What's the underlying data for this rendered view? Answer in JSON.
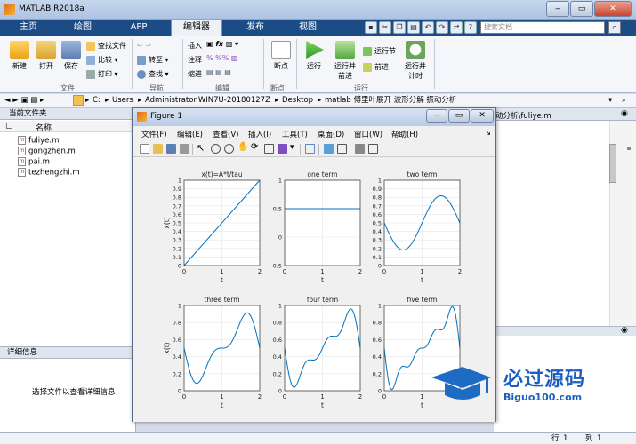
{
  "app": {
    "title": "MATLAB R2018a"
  },
  "tabs": [
    {
      "label": "主页"
    },
    {
      "label": "绘图"
    },
    {
      "label": "APP"
    },
    {
      "label": "编辑器"
    },
    {
      "label": "发布"
    },
    {
      "label": "视图"
    }
  ],
  "search": {
    "placeholder": "搜索文档"
  },
  "ribbon": {
    "new": "新建",
    "open": "打开",
    "save": "保存",
    "find_files": "查找文件",
    "compare": "比较",
    "print": "打印",
    "insert": "插入",
    "comment": "注释",
    "indent": "缩进",
    "goto": "转至",
    "find": "查找",
    "breakpoint": "断点",
    "run": "运行",
    "run_advance": "运行并\n前进",
    "run_section": "运行节",
    "advance": "前进",
    "run_time": "运行并\n计时",
    "groups": {
      "file": "文件",
      "nav": "导航",
      "edit": "编辑",
      "bp": "断点",
      "run": "运行"
    }
  },
  "address": {
    "segments": [
      "C:",
      "Users",
      "Administrator.WIN7U-20180127Z",
      "Desktop",
      "matlab 傅里叶展开 波形分解 振动分析"
    ]
  },
  "left_panel": {
    "title": "当前文件夹",
    "column": "名称",
    "files": [
      "fuliye.m",
      "gongzhen.m",
      "pai.m",
      "tezhengzhi.m"
    ],
    "details_title": "详细信息",
    "details_hint": "选择文件以查看详细信息"
  },
  "editor": {
    "tab_text": "动分析\\fuliye.m"
  },
  "status": {
    "row_label": "行",
    "row": "1",
    "col_label": "列",
    "col": "1"
  },
  "figure": {
    "title": "Figure 1",
    "menu": [
      "文件(F)",
      "编辑(E)",
      "查看(V)",
      "插入(I)",
      "工具(T)",
      "桌面(D)",
      "窗口(W)",
      "帮助(H)"
    ]
  },
  "chart_data": [
    {
      "type": "line",
      "title": "x(t)=A*t/tau",
      "xlabel": "t",
      "ylabel": "x(t)",
      "xlim": [
        0,
        2
      ],
      "ylim": [
        0,
        1
      ],
      "xticks": [
        0,
        1,
        2
      ],
      "yticks": [
        0,
        0.1,
        0.2,
        0.3,
        0.4,
        0.5,
        0.6,
        0.7,
        0.8,
        0.9,
        1
      ],
      "series": [
        {
          "x": [
            0,
            2
          ],
          "y": [
            0,
            1
          ]
        }
      ],
      "grid": true
    },
    {
      "type": "line",
      "title": "one term",
      "xlabel": "t",
      "ylabel": "",
      "xlim": [
        0,
        2
      ],
      "ylim": [
        -0.5,
        1
      ],
      "xticks": [
        0,
        1,
        2
      ],
      "yticks": [
        -0.5,
        0,
        0.5,
        1
      ],
      "series": [
        {
          "x": [
            0,
            2
          ],
          "y": [
            0.5,
            0.5
          ]
        }
      ],
      "grid": true
    },
    {
      "type": "line",
      "title": "two term",
      "xlabel": "t",
      "ylabel": "",
      "xlim": [
        0,
        2
      ],
      "ylim": [
        0,
        1
      ],
      "xticks": [
        0,
        1,
        2
      ],
      "yticks": [
        0,
        0.1,
        0.2,
        0.3,
        0.4,
        0.5,
        0.6,
        0.7,
        0.8,
        0.9,
        1
      ],
      "terms": 2,
      "grid": true
    },
    {
      "type": "line",
      "title": "three term",
      "xlabel": "t",
      "ylabel": "x(t)",
      "xlim": [
        0,
        2
      ],
      "ylim": [
        0,
        1
      ],
      "xticks": [
        0,
        1,
        2
      ],
      "yticks": [
        0,
        0.2,
        0.4,
        0.6,
        0.8,
        1
      ],
      "terms": 3,
      "grid": true
    },
    {
      "type": "line",
      "title": "four term",
      "xlabel": "t",
      "ylabel": "",
      "xlim": [
        0,
        2
      ],
      "ylim": [
        0,
        1
      ],
      "xticks": [
        0,
        1,
        2
      ],
      "yticks": [
        0,
        0.2,
        0.4,
        0.6,
        0.8,
        1
      ],
      "terms": 4,
      "grid": true
    },
    {
      "type": "line",
      "title": "five term",
      "xlabel": "t",
      "ylabel": "",
      "xlim": [
        0,
        2
      ],
      "ylim": [
        0,
        1
      ],
      "xticks": [
        0,
        1,
        2
      ],
      "yticks": [
        0,
        0.2,
        0.4,
        0.6,
        0.8,
        1
      ],
      "terms": 5,
      "grid": true
    }
  ],
  "watermark": {
    "brand": "必过源码",
    "url": "Biguo100.com"
  },
  "colors": {
    "accent": "#1c4c86",
    "line": "#0072bd"
  }
}
